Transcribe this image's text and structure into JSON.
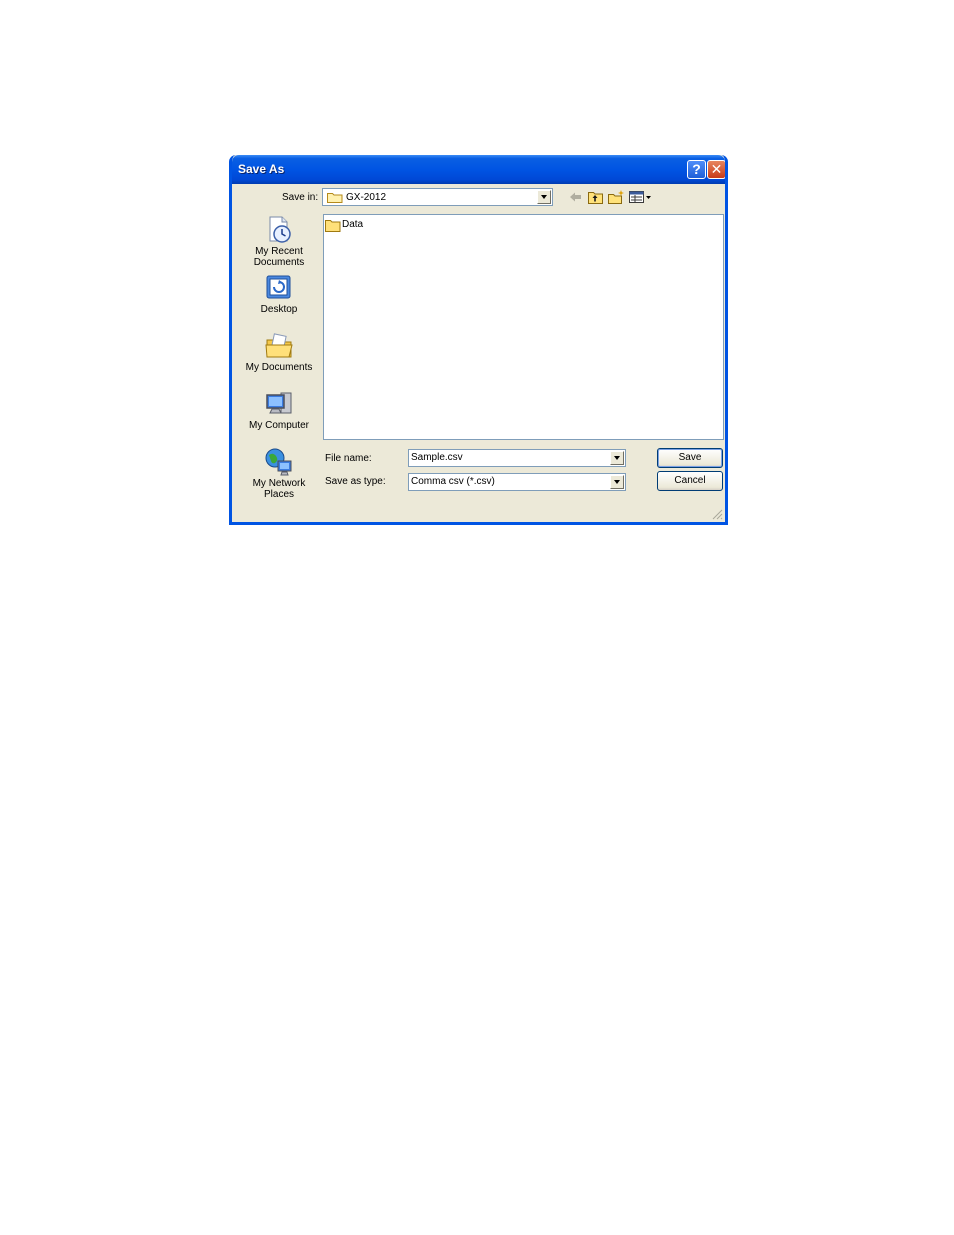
{
  "dialog": {
    "title": "Save As",
    "help_glyph": "?",
    "close_glyph": "✕"
  },
  "toolbar": {
    "save_in_label": "Save in:",
    "save_in_value": "GX-2012",
    "icons": [
      "back-arrow-icon",
      "up-folder-icon",
      "new-folder-icon",
      "views-menu-icon"
    ]
  },
  "places": [
    {
      "label": "My Recent Documents",
      "icon": "recent-documents-icon"
    },
    {
      "label": "Desktop",
      "icon": "desktop-icon"
    },
    {
      "label": "My Documents",
      "icon": "my-documents-icon"
    },
    {
      "label": "My Computer",
      "icon": "my-computer-icon"
    },
    {
      "label": "My Network Places",
      "icon": "network-places-icon"
    }
  ],
  "files": [
    {
      "name": "Data",
      "icon": "folder-icon"
    }
  ],
  "form": {
    "file_name_label": "File name:",
    "file_name_value": "Sample.csv",
    "save_type_label": "Save as type:",
    "save_type_value": "Comma csv (*.csv)"
  },
  "buttons": {
    "save": "Save",
    "cancel": "Cancel"
  },
  "colors": {
    "title_bar": "#0054e3",
    "dialog_bg": "#ece9d8",
    "close_button": "#c73b1a"
  }
}
